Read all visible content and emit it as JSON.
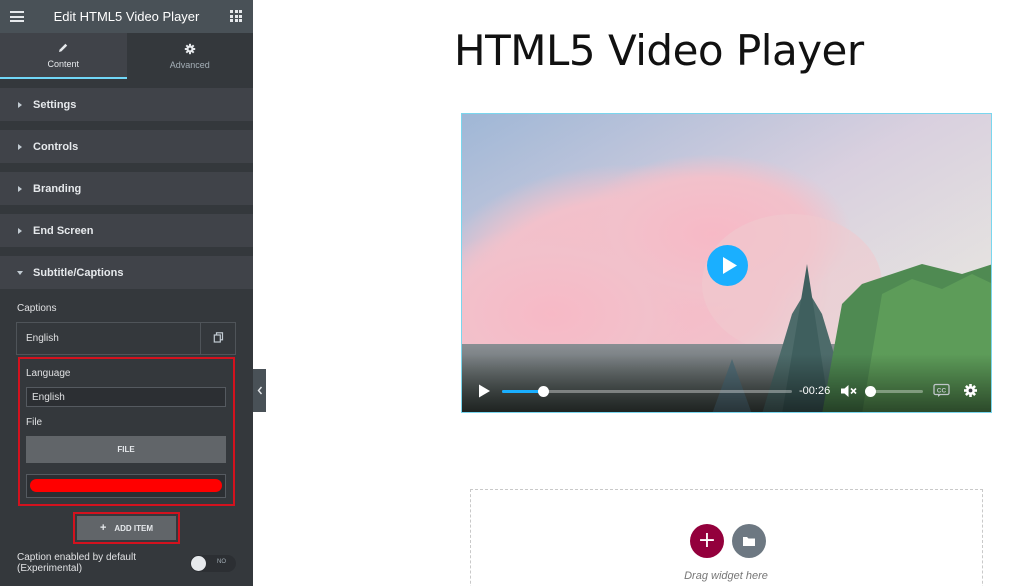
{
  "app": {
    "title": "Edit HTML5 Video Player"
  },
  "tabs": [
    {
      "label": "Content",
      "icon": "pencil-icon",
      "active": true
    },
    {
      "label": "Advanced",
      "icon": "gear-icon",
      "active": false
    }
  ],
  "sections": [
    {
      "label": "Settings",
      "open": false
    },
    {
      "label": "Controls",
      "open": false
    },
    {
      "label": "Branding",
      "open": false
    },
    {
      "label": "End Screen",
      "open": false
    },
    {
      "label": "Subtitle/Captions",
      "open": true
    }
  ],
  "captions": {
    "label": "Captions",
    "item_title": "English",
    "language_label": "Language",
    "language_value": "English",
    "file_label": "File",
    "file_button": "FILE",
    "add_item": "ADD ITEM",
    "default_label": "Caption enabled by default (Experimental)",
    "toggle_state": "NO"
  },
  "canvas": {
    "page_title": "HTML5 Video Player",
    "time_remaining": "-00:26",
    "progress": 0.14,
    "volume": 0.0,
    "drag_text": "Drag widget here"
  },
  "colors": {
    "sidebar": "#34383c",
    "accent": "#71d7f7",
    "player_accent": "#1aafff",
    "highlight": "#d3121e",
    "add_button": "#93003c"
  }
}
